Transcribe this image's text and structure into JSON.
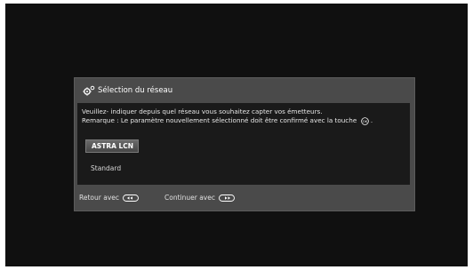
{
  "dialog": {
    "title": "Sélection du réseau",
    "header_icon": "gear-icon",
    "message_line1": "Veuillez- indiquer depuis quel réseau vous souhaitez capter vos émetteurs.",
    "message_line2": "Remarque : Le paramètre nouvellement sélectionné doit être confirmé avec la touche",
    "message_line2_end": ".",
    "ok_icon": "ok-button-icon",
    "options": [
      {
        "label": "ASTRA LCN",
        "selected": true
      },
      {
        "label": "Standard",
        "selected": false
      }
    ],
    "footer": {
      "back_label": "Retour avec",
      "back_icon": "back-button-icon",
      "continue_label": "Continuer avec",
      "continue_icon": "forward-button-icon"
    }
  },
  "colors": {
    "screen_background": "#101010",
    "dialog_frame": "#4a4a4a",
    "dialog_body": "#1a1a1a",
    "selected_option": "#5a5a5a",
    "text": "#ffffff"
  }
}
